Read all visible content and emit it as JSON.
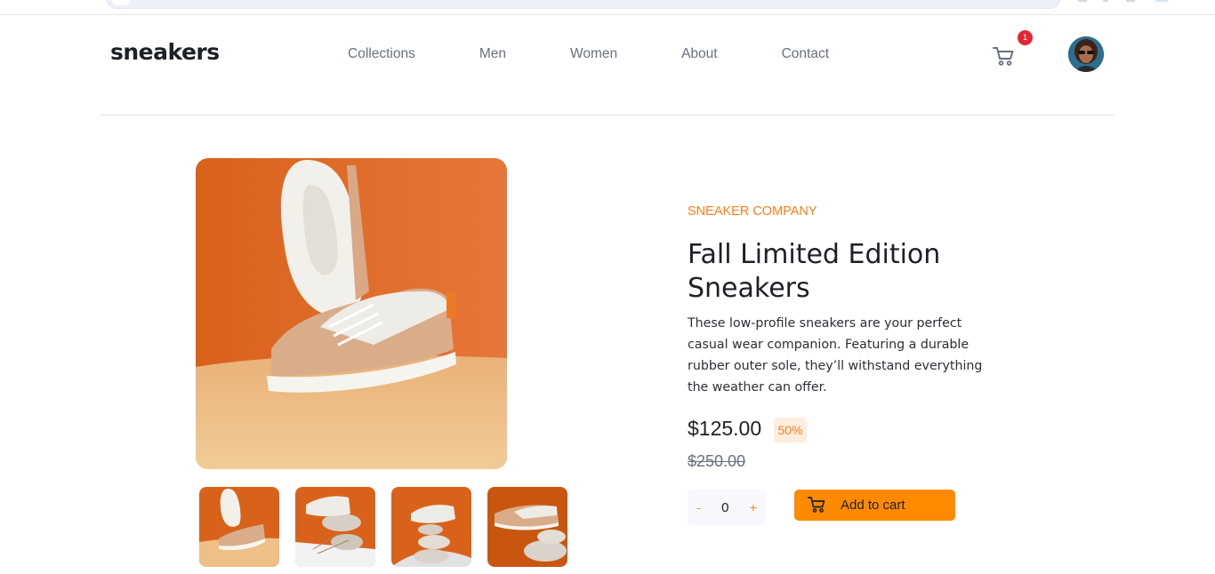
{
  "brand": {
    "logo": "sneakers",
    "accent": "#ff7d1a",
    "button_color": "#ff8a00",
    "badge_color": "#e32636"
  },
  "nav": {
    "items": [
      "Collections",
      "Men",
      "Women",
      "About",
      "Contact"
    ]
  },
  "cart": {
    "icon": "cart-icon",
    "count": "1"
  },
  "user": {
    "avatar_icon": "avatar"
  },
  "product": {
    "company": "SNEAKER COMPANY",
    "title": "Fall Limited Edition Sneakers",
    "description": "These low-profile sneakers are your perfect casual wear companion. Featuring a durable rubber outer sole, they’ll withstand everything the weather can offer.",
    "price": "$125.00",
    "discount": "50%",
    "original_price": "$250.00"
  },
  "purchase": {
    "decrement": "-",
    "quantity": "0",
    "increment": "+",
    "add_label": "Add to cart"
  }
}
